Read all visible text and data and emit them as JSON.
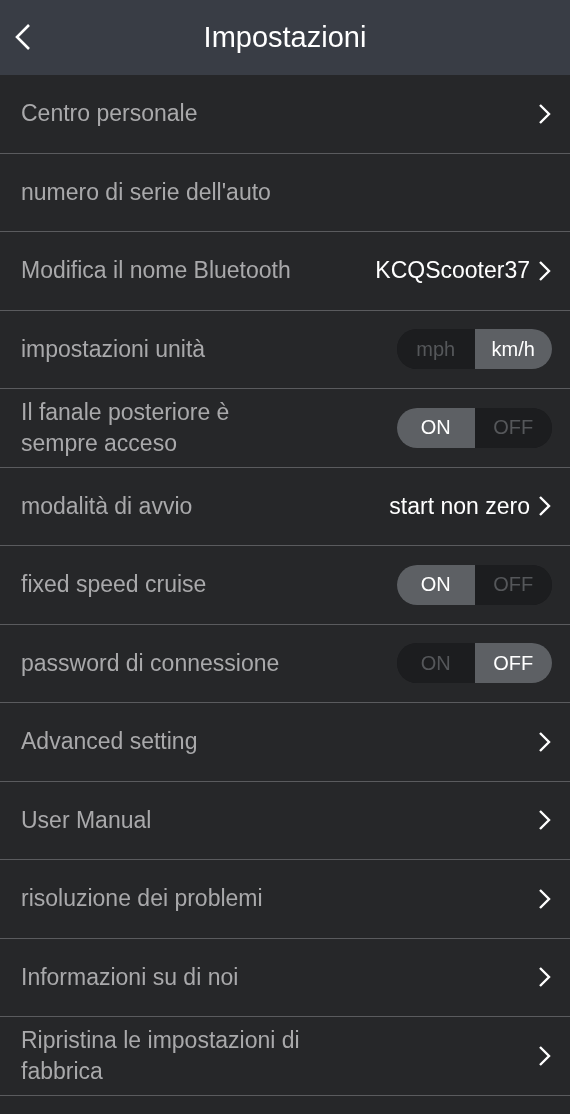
{
  "header": {
    "title": "Impostazioni"
  },
  "rows": [
    {
      "kind": "link",
      "label": "Centro personale"
    },
    {
      "kind": "plain",
      "label": "numero di serie dell'auto"
    },
    {
      "kind": "link",
      "label": "Modifica il nome Bluetooth",
      "value": "KCQScooter37"
    },
    {
      "kind": "toggle",
      "label": "impostazioni unità",
      "options": [
        {
          "label": "mph",
          "selected": false
        },
        {
          "label": "km/h",
          "selected": true
        }
      ]
    },
    {
      "kind": "toggle",
      "label": "Il fanale posteriore è sempre acceso",
      "options": [
        {
          "label": "ON",
          "selected": true
        },
        {
          "label": "OFF",
          "selected": false
        }
      ]
    },
    {
      "kind": "link",
      "label": "modalità di avvio",
      "value": "start non zero"
    },
    {
      "kind": "toggle",
      "label": "fixed speed cruise",
      "options": [
        {
          "label": "ON",
          "selected": true
        },
        {
          "label": "OFF",
          "selected": false
        }
      ]
    },
    {
      "kind": "toggle",
      "label": "password di connessione",
      "options": [
        {
          "label": "ON",
          "selected": false
        },
        {
          "label": "OFF",
          "selected": true
        }
      ]
    },
    {
      "kind": "link",
      "label": "Advanced setting"
    },
    {
      "kind": "link",
      "label": "User Manual"
    },
    {
      "kind": "link",
      "label": "risoluzione dei problemi"
    },
    {
      "kind": "link",
      "label": "Informazioni su di noi"
    },
    {
      "kind": "link",
      "label": "Ripristina le impostazioni di fabbrica"
    }
  ]
}
